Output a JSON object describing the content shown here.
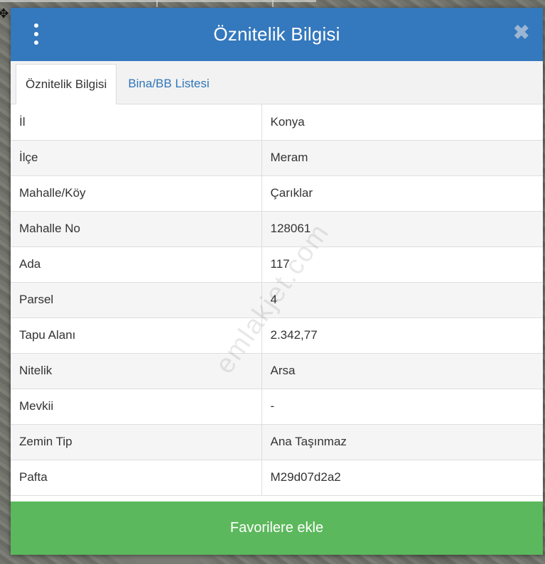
{
  "header": {
    "title": "Öznitelik Bilgisi",
    "close_symbol": "✖"
  },
  "tabs": [
    {
      "label": "Öznitelik Bilgisi",
      "active": true
    },
    {
      "label": "Bina/BB Listesi",
      "active": false
    }
  ],
  "attributes": [
    {
      "key": "İl",
      "value": "Konya"
    },
    {
      "key": "İlçe",
      "value": "Meram"
    },
    {
      "key": "Mahalle/Köy",
      "value": "Çarıklar"
    },
    {
      "key": "Mahalle No",
      "value": "128061"
    },
    {
      "key": "Ada",
      "value": "117"
    },
    {
      "key": "Parsel",
      "value": "4"
    },
    {
      "key": "Tapu Alanı",
      "value": "2.342,77"
    },
    {
      "key": "Nitelik",
      "value": "Arsa"
    },
    {
      "key": "Mevkii",
      "value": "-"
    },
    {
      "key": "Zemin Tip",
      "value": "Ana Taşınmaz"
    },
    {
      "key": "Pafta",
      "value": "M29d07d2a2"
    }
  ],
  "footer": {
    "favorite_label": "Favorilere ekle"
  },
  "watermark": "emlakjet.com",
  "colors": {
    "header": "#3478bd",
    "tab_link": "#2f76b8",
    "favorite_button": "#5cb85c"
  },
  "icons": {
    "menu": "kebab-menu-icon",
    "close": "close-icon",
    "map_target": "move-crosshair-icon"
  }
}
